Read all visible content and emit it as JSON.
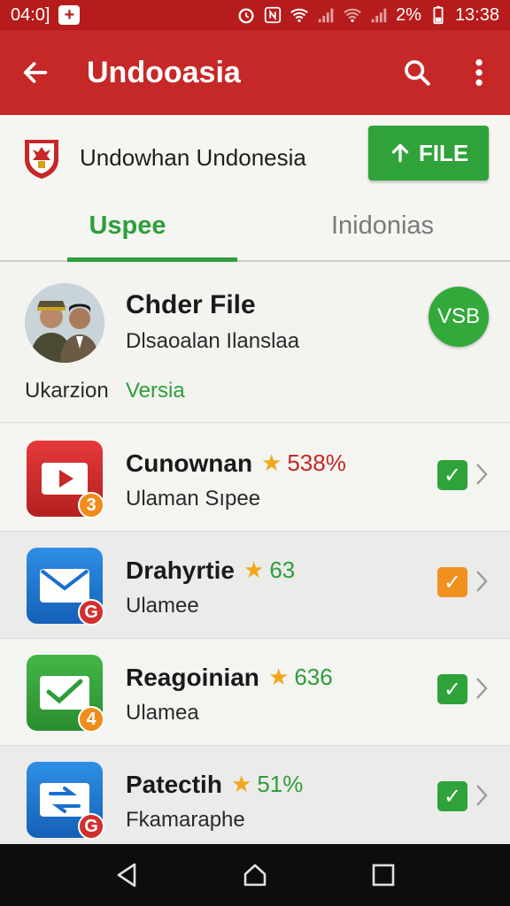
{
  "status_bar": {
    "time_left": "04:0]",
    "battery_percent": "2%",
    "time_right": "13:38",
    "icons": [
      "plus-notification-icon",
      "alarm-icon",
      "nfc-icon",
      "wifi-icon",
      "signal-icon",
      "battery-icon"
    ]
  },
  "app_bar": {
    "title": "Undooasia",
    "background": "#c62828"
  },
  "header": {
    "name": "Undowhan Undonesia",
    "upload_label": "FILE",
    "upload_color": "#2fa23a"
  },
  "tabs": [
    {
      "label": "Uspee",
      "active": true
    },
    {
      "label": "Inidonias",
      "active": false
    }
  ],
  "featured": {
    "title": "Chder File",
    "subtitle": "Dlsaoalan Ilanslaa",
    "left_label": "Ukarzion",
    "right_label": "Versia",
    "badge": "VSB"
  },
  "apps": [
    {
      "title": "Cunownan",
      "rating": "538%",
      "rating_color": "#c62828",
      "subtitle": "Ulaman Sıpee",
      "badge": "3",
      "badge_color": "#f08c1a",
      "icon": "video-play-icon",
      "check_color": "#2fa23a"
    },
    {
      "title": "Drahyrtie",
      "rating": "63",
      "rating_color": "#2e9e3a",
      "subtitle": "Ulamee",
      "badge": "G",
      "badge_color": "#d32f2f",
      "icon": "mail-icon",
      "check_color": "#f0901e"
    },
    {
      "title": "Reagoinian",
      "rating": "636",
      "rating_color": "#2e9e3a",
      "subtitle": "Ulamea",
      "badge": "4",
      "badge_color": "#f08c1a",
      "icon": "mail-check-icon",
      "check_color": "#2fa23a"
    },
    {
      "title": "Patectih",
      "rating": "51%",
      "rating_color": "#2e9e3a",
      "subtitle": "Fkamaraphe",
      "badge": "G",
      "badge_color": "#d32f2f",
      "icon": "mail-edit-icon",
      "check_color": "#2fa23a"
    }
  ]
}
